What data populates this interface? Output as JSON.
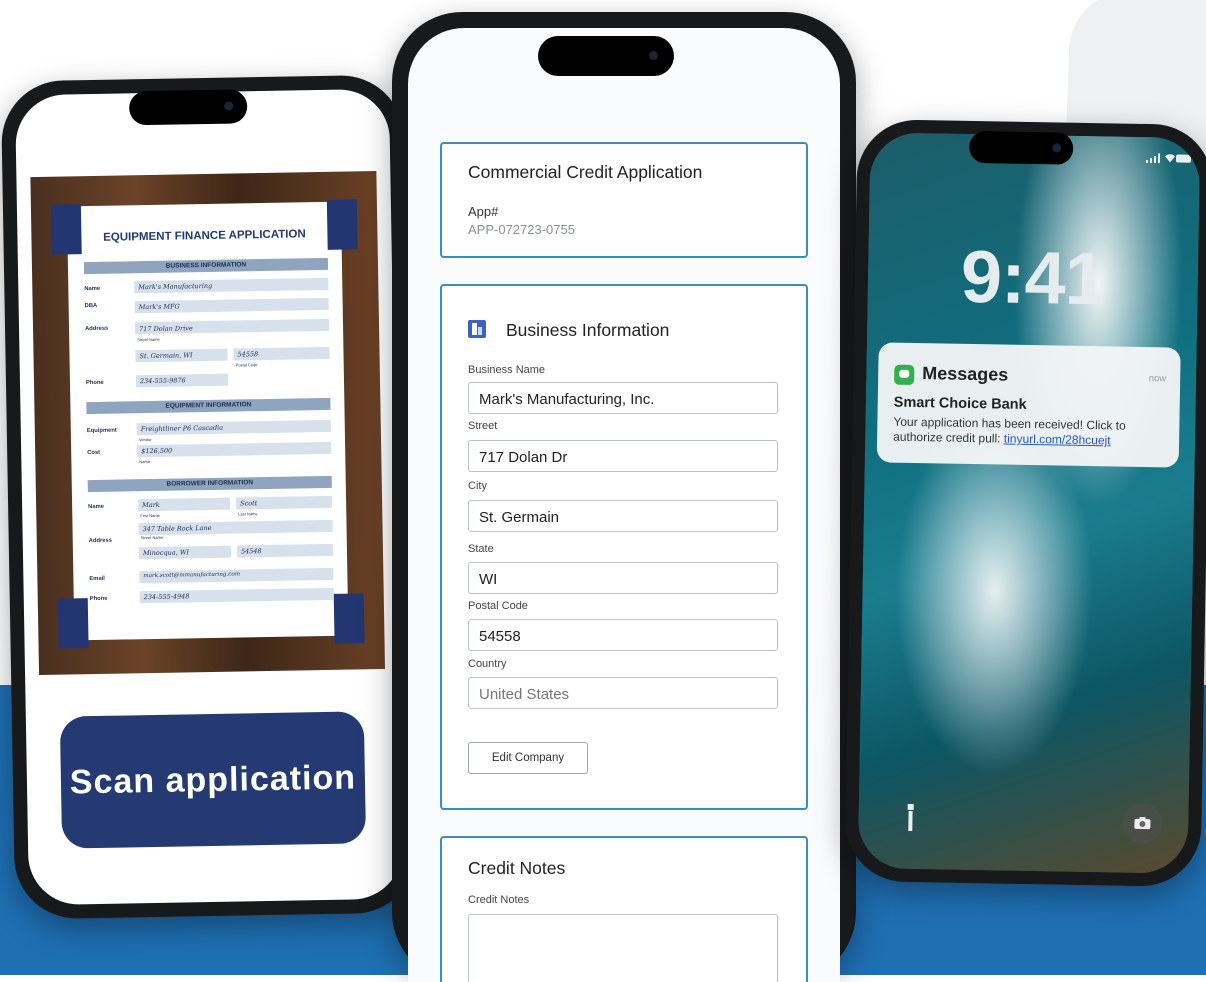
{
  "phone_scan": {
    "document": {
      "title": "EQUIPMENT FINANCE APPLICATION",
      "sections": {
        "business": "BUSINESS INFORMATION",
        "equipment": "EQUIPMENT INFORMATION",
        "borrower": "BORROWER INFORMATION"
      },
      "labels": {
        "name": "Name",
        "dba": "DBA",
        "address": "Address",
        "phone": "Phone",
        "equipment": "Equipment",
        "cost": "Cost",
        "borrower_name": "Name",
        "borrower_address": "Address",
        "email": "Email",
        "borrower_phone": "Phone"
      },
      "values": {
        "name": "Mark's Manufacturing",
        "dba": "Mark's MFG",
        "street": "717 Dolan Drive",
        "city": "St. Germain, WI",
        "zip": "54558",
        "phone": "234-555-9876",
        "equipment": "Freightliner P6 Cascadia",
        "cost": "$126,500",
        "first_name": "Mark",
        "last_name": "Scott",
        "borrower_street": "347 Table Rock Lane",
        "borrower_city": "Minocqua, WI",
        "borrower_zip": "54548",
        "email": "mark.scott@mmanufacturing.com",
        "borrower_phone": "234-555-4948"
      },
      "sublabels": {
        "street_name": "Street Name",
        "postal_code": "Postal Code",
        "vendor": "Vendor",
        "name": "Name",
        "first_name": "First Name",
        "last_name": "Last Name"
      }
    },
    "button_label": "Scan application"
  },
  "phone_form": {
    "app_card": {
      "title": "Commercial Credit Application",
      "app_label": "App#",
      "app_value": "APP-072723-0755"
    },
    "business_card": {
      "title": "Business Information",
      "fields": {
        "business_name": {
          "label": "Business Name",
          "value": "Mark's Manufacturing, Inc."
        },
        "street": {
          "label": "Street",
          "value": "717 Dolan Dr"
        },
        "city": {
          "label": "City",
          "value": "St. Germain"
        },
        "state": {
          "label": "State",
          "value": "WI"
        },
        "postal": {
          "label": "Postal Code",
          "value": "54558"
        },
        "country": {
          "label": "Country",
          "value": "United States"
        }
      },
      "edit_button": "Edit Company"
    },
    "notes_card": {
      "title": "Credit Notes",
      "label": "Credit Notes",
      "value": ""
    }
  },
  "phone_lock": {
    "time": "9:41",
    "notification": {
      "app": "Messages",
      "when": "now",
      "sender": "Smart Choice Bank",
      "body": "Your application has been received! Click to authorize credit pull:",
      "link": "tinyurl.com/28hcuejt"
    },
    "icons": [
      "flashlight-icon",
      "camera-icon",
      "signal-icon",
      "wifi-icon",
      "battery-icon"
    ]
  }
}
